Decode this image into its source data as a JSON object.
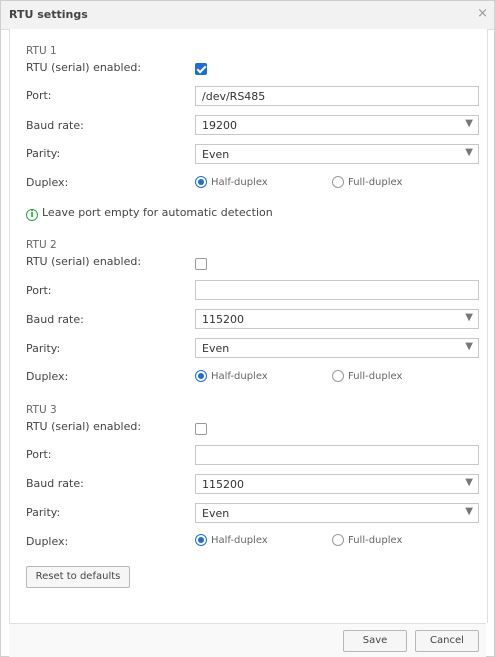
{
  "dialog": {
    "title": "RTU settings",
    "close": "×"
  },
  "rtus": [
    {
      "header": "RTU 1",
      "enabled_label": "RTU (serial) enabled:",
      "enabled": true,
      "port_label": "Port:",
      "port_value": "/dev/RS485",
      "baud_label": "Baud rate:",
      "baud_value": "19200",
      "parity_label": "Parity:",
      "parity_value": "Even",
      "duplex_label": "Duplex:",
      "half": "Half-duplex",
      "full": "Full-duplex",
      "duplex_selected": "Half-duplex"
    },
    {
      "header": "RTU 2",
      "enabled_label": "RTU (serial) enabled:",
      "enabled": false,
      "port_label": "Port:",
      "port_value": "",
      "baud_label": "Baud rate:",
      "baud_value": "115200",
      "parity_label": "Parity:",
      "parity_value": "Even",
      "duplex_label": "Duplex:",
      "half": "Half-duplex",
      "full": "Full-duplex",
      "duplex_selected": "Half-duplex"
    },
    {
      "header": "RTU 3",
      "enabled_label": "RTU (serial) enabled:",
      "enabled": false,
      "port_label": "Port:",
      "port_value": "",
      "baud_label": "Baud rate:",
      "baud_value": "115200",
      "parity_label": "Parity:",
      "parity_value": "Even",
      "duplex_label": "Duplex:",
      "half": "Half-duplex",
      "full": "Full-duplex",
      "duplex_selected": "Half-duplex"
    }
  ],
  "hint": {
    "text": "Leave port empty for automatic detection",
    "icon": "info-icon"
  },
  "buttons": {
    "reset": "Reset to defaults",
    "save": "Save",
    "cancel": "Cancel"
  },
  "colors": {
    "accent": "#1b6fd6",
    "hint_icon": "#25a637"
  }
}
